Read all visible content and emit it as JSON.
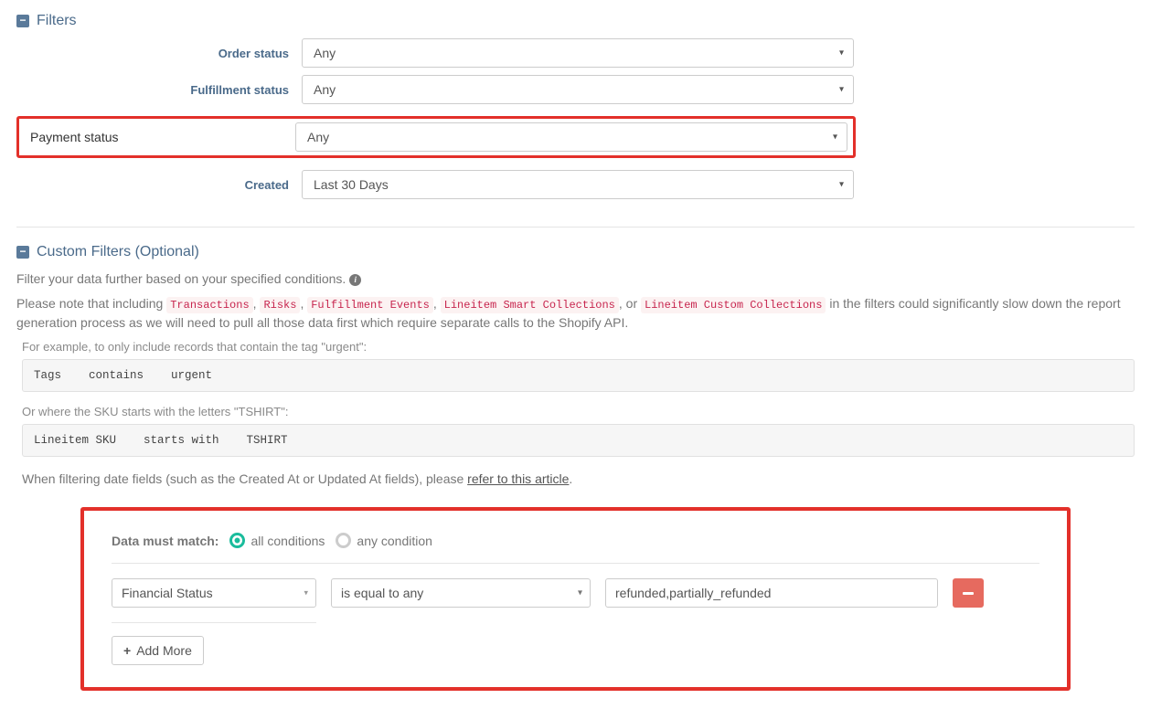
{
  "filters_section": {
    "title": "Filters",
    "rows": {
      "order_status": {
        "label": "Order status",
        "value": "Any"
      },
      "fulfillment": {
        "label": "Fulfillment status",
        "value": "Any"
      },
      "payment": {
        "label": "Payment status",
        "value": "Any"
      },
      "created": {
        "label": "Created",
        "value": "Last 30 Days"
      }
    }
  },
  "custom_filters_section": {
    "title": "Custom Filters (Optional)",
    "intro": "Filter your data further based on your specified conditions. ",
    "note_pre": "Please note that including ",
    "tags": {
      "transactions": "Transactions",
      "risks": "Risks",
      "fulfillment_events": "Fulfillment Events",
      "lineitem_smart": "Lineitem Smart Collections",
      "lineitem_custom": "Lineitem Custom Collections"
    },
    "sep_comma": ", ",
    "sep_or": ", or ",
    "note_post": " in the filters could significantly slow down the report generation process as we will need to pull all those data first which require separate calls to the Shopify API.",
    "examples": {
      "ex1_label": "For example, to only include records that contain the tag \"urgent\":",
      "ex1_code": "Tags    contains    urgent",
      "ex2_label": "Or where the SKU starts with the letters \"TSHIRT\":",
      "ex2_code": "Lineitem SKU    starts with    TSHIRT"
    },
    "date_note_pre": "When filtering date fields (such as the Created At or Updated At fields), please ",
    "date_note_link": "refer to this article",
    "date_note_post": "."
  },
  "conditions": {
    "match_label": "Data must match:",
    "opt_all": "all conditions",
    "opt_any": "any condition",
    "row": {
      "field": "Financial Status",
      "operator": "is equal to any",
      "value": "refunded,partially_refunded"
    },
    "add_more": "Add More"
  }
}
